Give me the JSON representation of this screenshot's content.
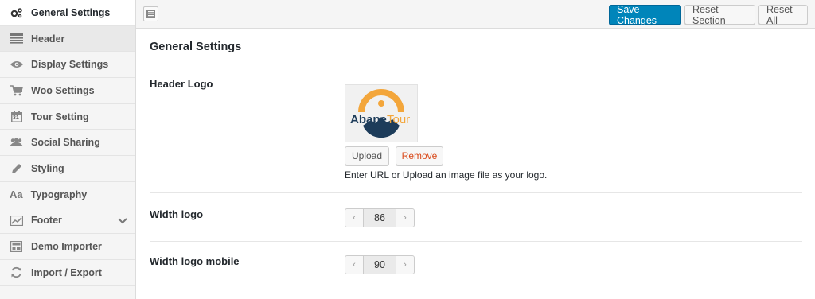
{
  "sidebar": {
    "items": [
      {
        "label": "General Settings",
        "icon": "gears-icon"
      },
      {
        "label": "Header",
        "icon": "header-icon"
      },
      {
        "label": "Display Settings",
        "icon": "eye-icon"
      },
      {
        "label": "Woo Settings",
        "icon": "cart-icon"
      },
      {
        "label": "Tour Setting",
        "icon": "calendar-icon",
        "icon_text": "31"
      },
      {
        "label": "Social Sharing",
        "icon": "users-icon"
      },
      {
        "label": "Styling",
        "icon": "pencil-icon"
      },
      {
        "label": "Typography",
        "icon": "typography-icon",
        "icon_text": "Aa"
      },
      {
        "label": "Footer",
        "icon": "chart-icon"
      },
      {
        "label": "Demo Importer",
        "icon": "layout-icon"
      },
      {
        "label": "Import / Export",
        "icon": "refresh-icon"
      }
    ]
  },
  "toolbar": {
    "save_label": "Save Changes",
    "reset_section_label": "Reset Section",
    "reset_all_label": "Reset All"
  },
  "main": {
    "section_title": "General Settings",
    "header_logo": {
      "label": "Header Logo",
      "logo_text_part1": "Abape",
      "logo_text_part2": "Tour",
      "upload_label": "Upload",
      "remove_label": "Remove",
      "help_text": "Enter URL or Upload an image file as your logo."
    },
    "width_logo": {
      "label": "Width logo",
      "value": "86"
    },
    "width_logo_mobile": {
      "label": "Width logo mobile",
      "value": "90"
    }
  },
  "colors": {
    "primary_button": "#0085ba",
    "remove_text": "#d9491a",
    "logo_orange": "#f3a63b",
    "logo_navy": "#1d3c5a"
  }
}
